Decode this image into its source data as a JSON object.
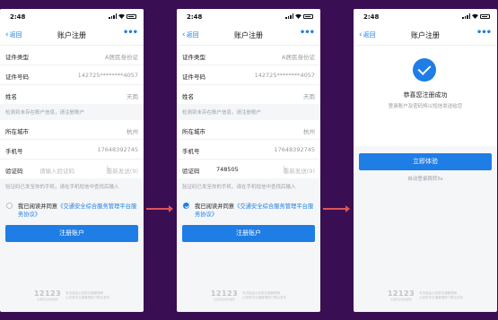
{
  "status": {
    "time": "2:48"
  },
  "nav": {
    "back": "返回",
    "title": "账户注册",
    "more": "•••",
    "title_success": "账户注册"
  },
  "form": {
    "id_type_label": "证件类型",
    "id_type_value": "A居民身份证",
    "id_number_label": "证件号码",
    "id_number_value": "142725********4057",
    "name_label": "姓名",
    "name_value": "天雨",
    "hint1": "检测到未存在账户信息，请注册账户",
    "city_label": "所在城市",
    "city_value": "杭州",
    "phone_label": "手机号",
    "phone_value": "17648392745",
    "code_label": "验证码",
    "code_placeholder": "请输入验证码",
    "code_value": "748505",
    "resend_label": "重新发送(9)",
    "hint2": "验证码已发至你的手机，请在手机短信中查找后输入",
    "agree_prefix": "我已阅读并同意",
    "agree_link": "《交通安全综合服务管理平台服务协议》",
    "submit_label": "注册账户"
  },
  "success": {
    "title": "恭喜您注册成功",
    "subtitle": "登录账户及密码将以短信发送给您",
    "button_label": "立即体验",
    "auto_text": "自动登录跳转5s"
  },
  "footer": {
    "logo": "12123",
    "logo_sub": "交通安全综合服务",
    "line1": "本页面由公安部交通管理局",
    "line2": "公安机关交通管理部门联合发布"
  },
  "colors": {
    "accent": "#1f7de6",
    "background": "#3a0e52",
    "arrow": "#e05555"
  }
}
